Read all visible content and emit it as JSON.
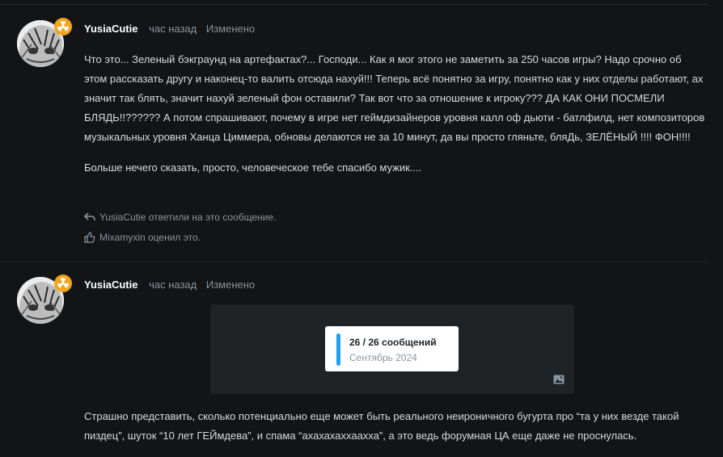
{
  "post1": {
    "username": "YusiaCutie",
    "time": "час назад",
    "edited": "Изменено",
    "paragraphs": [
      "Что это... Зеленый бэкграунд на артефактах?... Господи... Как я мог этого не заметить за 250 часов игры? Надо срочно об этом рассказать другу и наконец-то валить отсюда нахуй!!! Теперь всё понятно за игру, понятно как у них отделы работают, ах значит так блять, значит нахуй зеленый фон оставили? Так вот что за отношение к игроку??? ДА КАК ОНИ ПОСМЕЛИ БЛЯДЬ!!?????? А потом спрашивают, почему в игре нет геймдизайнеров уровня калл оф дьюти - батлфилд, нет композиторов музыкальных уровня Ханца Циммера, обновы делаются не за 10 минут, да вы просто гляньте, бляДь, ЗЕЛЁНЫЙ !!!! ФОН!!!!",
      "Больше нечего сказать, просто, человеческое тебе спасибо мужик...."
    ],
    "reply_text": "YusiaCutie ответили на это сообщение.",
    "like_text": "Mixamyxin оценил это."
  },
  "post2": {
    "username": "YusiaCutie",
    "time": "час назад",
    "edited": "Изменено",
    "embed": {
      "title": "26 / 26 сообщений",
      "date": "Сентябрь 2024",
      "accent": "#1da1f2"
    },
    "paragraphs": [
      "Страшно представить, сколько потенциально еще может быть реального неироничного бугурта про “та у них везде такой пиздец”, шуток “10 лет ГЕЙмдева”, и спама “ахахахаххаахха”, а это ведь форумная ЦА еще даже не проснулась."
    ]
  },
  "icons": {
    "badge": "radiation-icon",
    "reply": "reply-arrow-icon",
    "like": "thumbs-up-icon",
    "image": "image-icon"
  },
  "colors": {
    "background": "#121416",
    "badge": "#f2a51e",
    "muted": "#8a95a0"
  }
}
